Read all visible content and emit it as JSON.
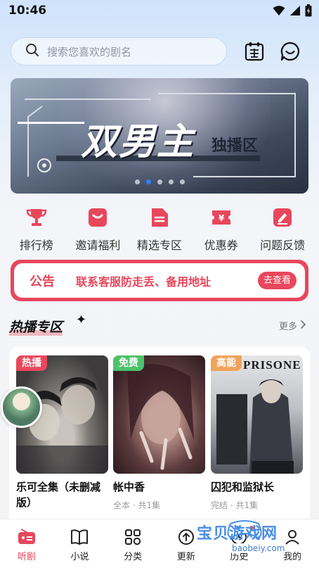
{
  "status": {
    "time": "10:46"
  },
  "search": {
    "placeholder": "搜索您喜欢的剧名"
  },
  "banner": {
    "title": "双男主",
    "subtitle": "独播区",
    "dots": [
      false,
      true,
      false,
      false,
      false
    ]
  },
  "quick_menu": [
    {
      "label": "排行榜",
      "icon": "trophy-icon"
    },
    {
      "label": "邀请福利",
      "icon": "gift-icon"
    },
    {
      "label": "精选专区",
      "icon": "document-icon"
    },
    {
      "label": "优惠券",
      "icon": "coupon-icon"
    },
    {
      "label": "问题反馈",
      "icon": "edit-icon"
    }
  ],
  "notice": {
    "tag": "公告",
    "text": "联系客服防走丢、备用地址",
    "button": "去查看"
  },
  "section": {
    "title": "热播专区",
    "more": "更多"
  },
  "cards": [
    {
      "badge": "热播",
      "badge_color": "#e8475c",
      "title": "乐可全集（未删减版）",
      "meta": ""
    },
    {
      "badge": "免费",
      "badge_color": "#4cc36a",
      "title": "帐中香",
      "meta": "全本 · 共1集"
    },
    {
      "badge": "高能",
      "badge_color": "#f0a35a",
      "title": "囚犯和监狱长",
      "meta": "完结 · 共1集",
      "poster_text": "PRISONE"
    }
  ],
  "bottom_nav": [
    {
      "label": "听剧",
      "icon": "radio-icon",
      "active": true
    },
    {
      "label": "小说",
      "icon": "book-icon",
      "active": false
    },
    {
      "label": "分类",
      "icon": "grid-icon",
      "active": false
    },
    {
      "label": "更新",
      "icon": "update-icon",
      "active": false
    },
    {
      "label": "历史",
      "icon": "history-icon",
      "active": false
    },
    {
      "label": "我的",
      "icon": "user-icon",
      "active": false
    }
  ],
  "watermark": {
    "text": "宝贝游戏网",
    "url": "baobeiy.com"
  },
  "colors": {
    "accent": "#e8475c",
    "active_dot": "#2f7fff"
  }
}
